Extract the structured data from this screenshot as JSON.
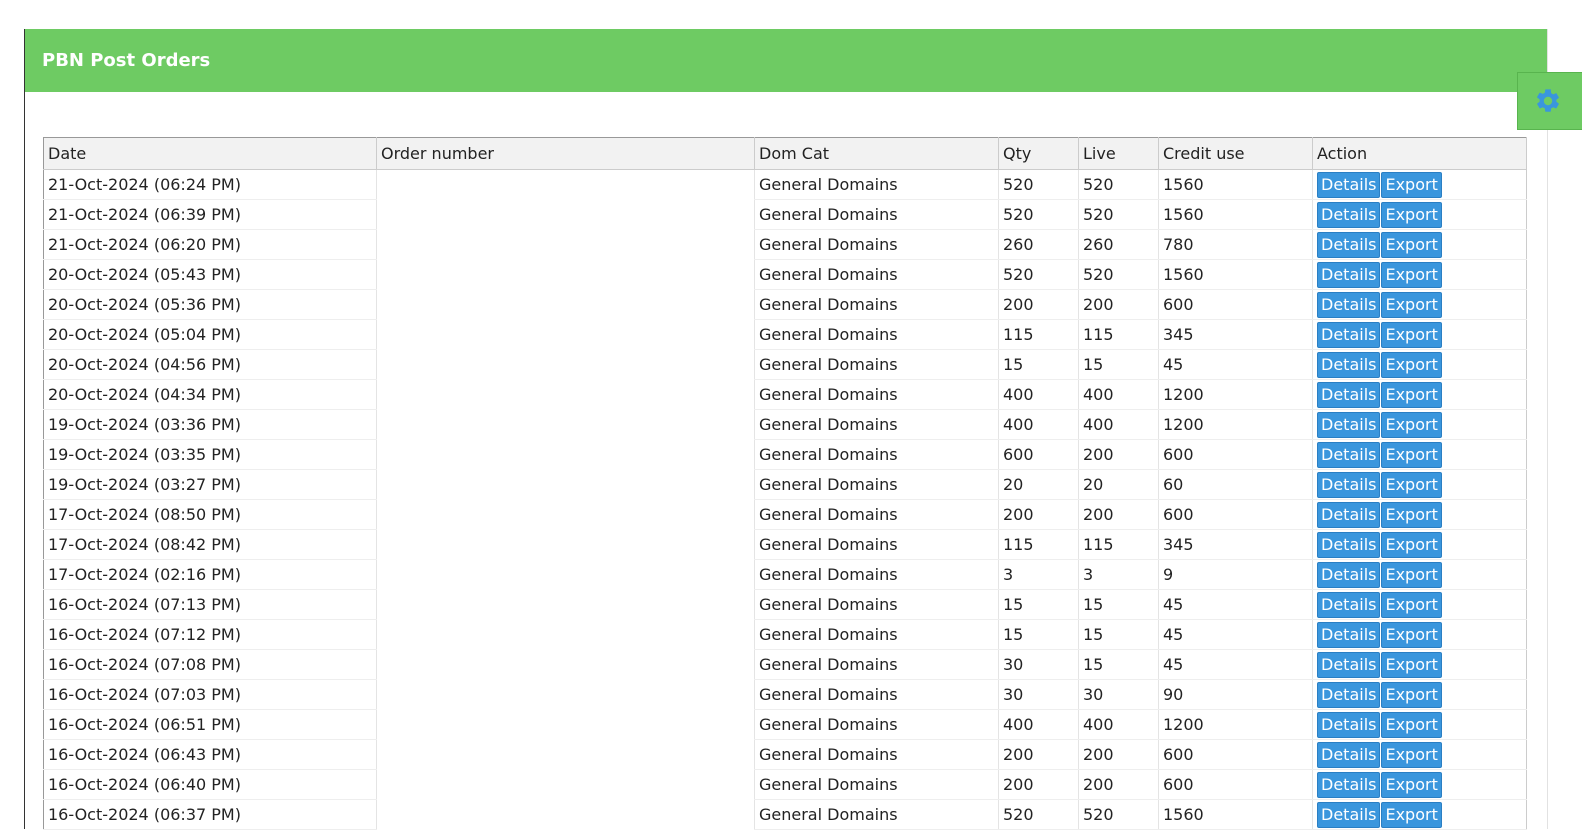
{
  "panel": {
    "title": "PBN Post Orders"
  },
  "toolbar": {
    "settings_icon": "gear-icon"
  },
  "colors": {
    "header_green": "#6ecb63",
    "button_blue": "#3a96dd"
  },
  "table": {
    "columns": [
      "Date",
      "Order number",
      "Dom Cat",
      "Qty",
      "Live",
      "Credit use",
      "Action"
    ],
    "action_labels": {
      "details": "Details",
      "export": "Export"
    },
    "rows": [
      {
        "date": "21-Oct-2024 (06:24 PM)",
        "order": "",
        "cat": "General Domains",
        "qty": "520",
        "live": "520",
        "credit": "1560"
      },
      {
        "date": "21-Oct-2024 (06:39 PM)",
        "order": "",
        "cat": "General Domains",
        "qty": "520",
        "live": "520",
        "credit": "1560"
      },
      {
        "date": "21-Oct-2024 (06:20 PM)",
        "order": "",
        "cat": "General Domains",
        "qty": "260",
        "live": "260",
        "credit": "780"
      },
      {
        "date": "20-Oct-2024 (05:43 PM)",
        "order": "",
        "cat": "General Domains",
        "qty": "520",
        "live": "520",
        "credit": "1560"
      },
      {
        "date": "20-Oct-2024 (05:36 PM)",
        "order": "",
        "cat": "General Domains",
        "qty": "200",
        "live": "200",
        "credit": "600"
      },
      {
        "date": "20-Oct-2024 (05:04 PM)",
        "order": "",
        "cat": "General Domains",
        "qty": "115",
        "live": "115",
        "credit": "345"
      },
      {
        "date": "20-Oct-2024 (04:56 PM)",
        "order": "",
        "cat": "General Domains",
        "qty": "15",
        "live": "15",
        "credit": "45"
      },
      {
        "date": "20-Oct-2024 (04:34 PM)",
        "order": "",
        "cat": "General Domains",
        "qty": "400",
        "live": "400",
        "credit": "1200"
      },
      {
        "date": "19-Oct-2024 (03:36 PM)",
        "order": "",
        "cat": "General Domains",
        "qty": "400",
        "live": "400",
        "credit": "1200"
      },
      {
        "date": "19-Oct-2024 (03:35 PM)",
        "order": "",
        "cat": "General Domains",
        "qty": "600",
        "live": "200",
        "credit": "600"
      },
      {
        "date": "19-Oct-2024 (03:27 PM)",
        "order": "",
        "cat": "General Domains",
        "qty": "20",
        "live": "20",
        "credit": "60"
      },
      {
        "date": "17-Oct-2024 (08:50 PM)",
        "order": "",
        "cat": "General Domains",
        "qty": "200",
        "live": "200",
        "credit": "600"
      },
      {
        "date": "17-Oct-2024 (08:42 PM)",
        "order": "",
        "cat": "General Domains",
        "qty": "115",
        "live": "115",
        "credit": "345"
      },
      {
        "date": "17-Oct-2024 (02:16 PM)",
        "order": "",
        "cat": "General Domains",
        "qty": "3",
        "live": "3",
        "credit": "9"
      },
      {
        "date": "16-Oct-2024 (07:13 PM)",
        "order": "",
        "cat": "General Domains",
        "qty": "15",
        "live": "15",
        "credit": "45"
      },
      {
        "date": "16-Oct-2024 (07:12 PM)",
        "order": "",
        "cat": "General Domains",
        "qty": "15",
        "live": "15",
        "credit": "45"
      },
      {
        "date": "16-Oct-2024 (07:08 PM)",
        "order": "",
        "cat": "General Domains",
        "qty": "30",
        "live": "15",
        "credit": "45"
      },
      {
        "date": "16-Oct-2024 (07:03 PM)",
        "order": "",
        "cat": "General Domains",
        "qty": "30",
        "live": "30",
        "credit": "90"
      },
      {
        "date": "16-Oct-2024 (06:51 PM)",
        "order": "",
        "cat": "General Domains",
        "qty": "400",
        "live": "400",
        "credit": "1200"
      },
      {
        "date": "16-Oct-2024 (06:43 PM)",
        "order": "",
        "cat": "General Domains",
        "qty": "200",
        "live": "200",
        "credit": "600"
      },
      {
        "date": "16-Oct-2024 (06:40 PM)",
        "order": "",
        "cat": "General Domains",
        "qty": "200",
        "live": "200",
        "credit": "600"
      },
      {
        "date": "16-Oct-2024 (06:37 PM)",
        "order": "",
        "cat": "General Domains",
        "qty": "520",
        "live": "520",
        "credit": "1560"
      }
    ]
  }
}
